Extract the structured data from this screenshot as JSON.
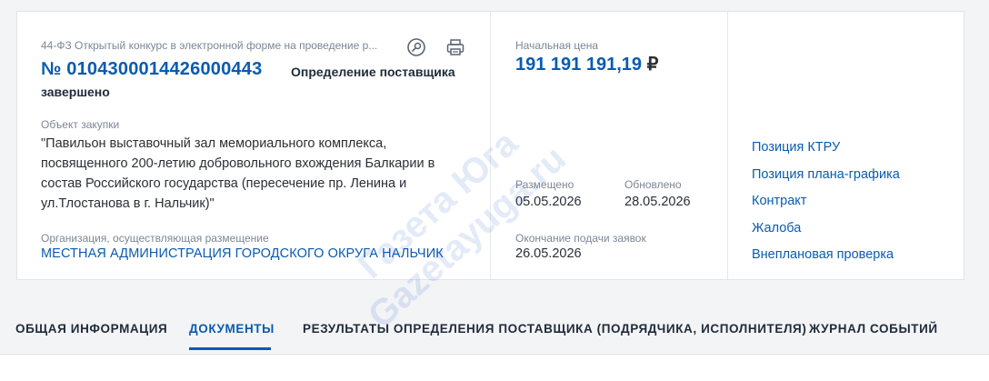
{
  "card": {
    "procurement_type": "44-ФЗ  Открытый конкурс в электронной форме на проведение р...",
    "purchase_number": "№ 0104300014426000443",
    "status_line1": "Определение поставщика",
    "status_line2": "завершено",
    "object_label": "Объект закупки",
    "object_text": "\"Павильон выставочный зал мемориального комплекса, посвященного 200-летию добровольного вхождения Балкарии в состав Российского государства (пересечение пр. Ленина и ул.Тлостанова в г. Нальчик)\"",
    "org_label": "Организация, осуществляющая размещение",
    "org_name": "МЕСТНАЯ АДМИНИСТРАЦИЯ ГОРОДСКОГО ОКРУГА НАЛЬЧИК",
    "icons": {
      "search": "search-icon",
      "print": "print-icon"
    }
  },
  "price": {
    "label": "Начальная цена",
    "value": "191 191 191,19",
    "currency": "₽"
  },
  "dates": {
    "placed_label": "Размещено",
    "placed_value": "05.05.2026",
    "updated_label": "Обновлено",
    "updated_value": "28.05.2026",
    "deadline_label": "Окончание подачи заявок",
    "deadline_value": "26.05.2026"
  },
  "links": [
    "Позиция КТРУ",
    "Позиция плана-графика",
    "Контракт",
    "Жалоба",
    "Внеплановая проверка"
  ],
  "watermark": {
    "line1": "Газета Юга",
    "line2": "Gazetayuga.ru"
  },
  "tabs": [
    "ОБЩАЯ ИНФОРМАЦИЯ",
    "ДОКУМЕНТЫ",
    "РЕЗУЛЬТАТЫ ОПРЕДЕЛЕНИЯ ПОСТАВЩИКА (ПОДРЯДЧИКА, ИСПОЛНИТЕЛЯ)",
    "ЖУРНАЛ СОБЫТИЙ"
  ],
  "active_tab": "ДОКУМЕНТЫ",
  "colors": {
    "accent": "#0a5bb0",
    "background": "#f3f4f6",
    "text": "#1f2b3a"
  }
}
